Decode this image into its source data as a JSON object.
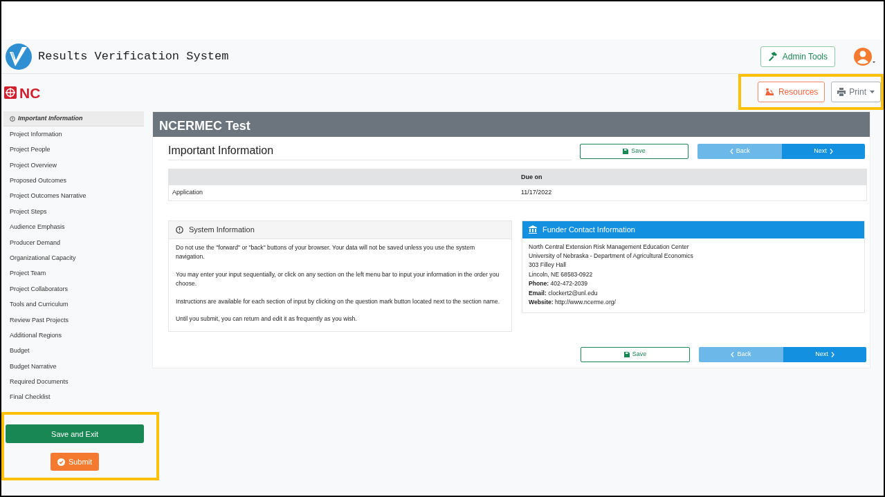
{
  "header": {
    "title": "Results Verification System",
    "admin_button": "Admin Tools"
  },
  "org_logo": {
    "text": "NC"
  },
  "toolbar": {
    "highlighted": true,
    "resources_button": "Resources",
    "print_button": "Print"
  },
  "sidebar": {
    "items": [
      {
        "label": "Important Information",
        "selected": true
      },
      {
        "label": "Project Information",
        "selected": false
      },
      {
        "label": "Project People",
        "selected": false
      },
      {
        "label": "Project Overview",
        "selected": false
      },
      {
        "label": "Proposed Outcomes",
        "selected": false
      },
      {
        "label": "Project Outcomes Narrative",
        "selected": false
      },
      {
        "label": "Project Steps",
        "selected": false
      },
      {
        "label": "Audience Emphasis",
        "selected": false
      },
      {
        "label": "Producer Demand",
        "selected": false
      },
      {
        "label": "Organizational Capacity",
        "selected": false
      },
      {
        "label": "Project Team",
        "selected": false
      },
      {
        "label": "Project Collaborators",
        "selected": false
      },
      {
        "label": "Tools and Curriculum",
        "selected": false
      },
      {
        "label": "Review Past Projects",
        "selected": false
      },
      {
        "label": "Additional Regions",
        "selected": false
      },
      {
        "label": "Budget",
        "selected": false
      },
      {
        "label": "Budget Narrative",
        "selected": false
      },
      {
        "label": "Required Documents",
        "selected": false
      },
      {
        "label": "Final Checklist",
        "selected": false
      }
    ],
    "actions_highlighted": true,
    "save_exit_button": "Save and Exit",
    "submit_button": "Submit"
  },
  "main": {
    "title": "NCERMEC Test",
    "section_title": "Important Information",
    "nav_top": {
      "save": "Save",
      "back": "Back",
      "next": "Next"
    },
    "table": {
      "columns": [
        {},
        {
          "label": "Due on"
        }
      ],
      "rows": [
        [
          "Application",
          "11/17/2022"
        ]
      ]
    },
    "system_info": {
      "title": "System Information",
      "paragraphs": [
        "Do not use the \"forward\" or \"back\" buttons of your browser. Your data will not be saved unless you use the system navigation.",
        "You may enter your input sequentially, or click on any section on the left menu bar to input your information in the order you choose.",
        "Instructions are available for each section of input by clicking on the question mark button located next to the section name.",
        "Until you submit, you can return and edit it as frequently as you wish."
      ]
    },
    "funder_contact": {
      "title": "Funder Contact Information",
      "lines": [
        "North Central Extension Risk Management Education Center",
        "University of Nebraska - Department of Agricultural Economics",
        "303 Filley Hall",
        "Lincoln, NE 68583-0922",
        "**Phone:** 402-472-2039",
        "**Email:** clockert2@unl.edu",
        "**Website:** http://www.ncerme.org/"
      ]
    },
    "nav_bottom": {
      "save": "Save",
      "back": "Back",
      "next": "Next"
    }
  }
}
